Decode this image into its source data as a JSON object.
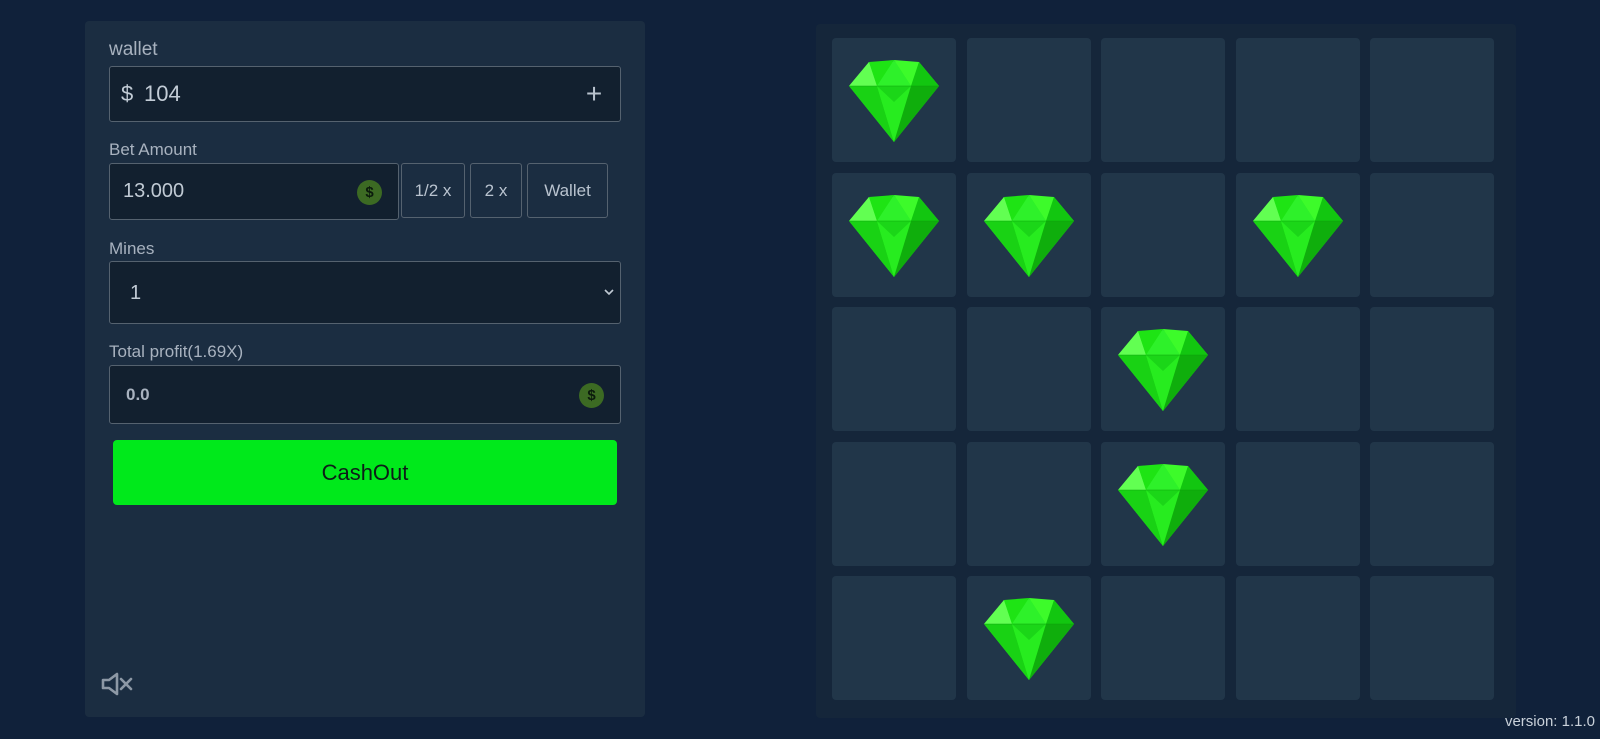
{
  "wallet": {
    "label": "wallet",
    "currency_symbol": "$",
    "balance": "104",
    "add_symbol": "+"
  },
  "bet": {
    "label": "Bet Amount",
    "amount": "13.000",
    "coin_symbol": "$",
    "half_label": "1/2 x",
    "double_label": "2 x",
    "wallet_label": "Wallet"
  },
  "mines": {
    "label": "Mines",
    "selected": "1"
  },
  "profit": {
    "label": "Total profit(1.69X)",
    "value": "0.0",
    "coin_symbol": "$"
  },
  "cashout_label": "CashOut",
  "sound": {
    "icon": "speaker-muted-icon"
  },
  "board": {
    "rows": 5,
    "cols": 5,
    "gem_icon": "green-gem-icon",
    "revealed_gems": [
      [
        0,
        0
      ],
      [
        1,
        0
      ],
      [
        1,
        1
      ],
      [
        1,
        3
      ],
      [
        2,
        2
      ],
      [
        3,
        2
      ],
      [
        4,
        1
      ]
    ]
  },
  "version": "version: 1.1.0",
  "colors": {
    "background": "#10213a",
    "panel": "#1b2d41",
    "tile": "#213649",
    "accent_green": "#00e91b",
    "gem": "#22f51a"
  }
}
